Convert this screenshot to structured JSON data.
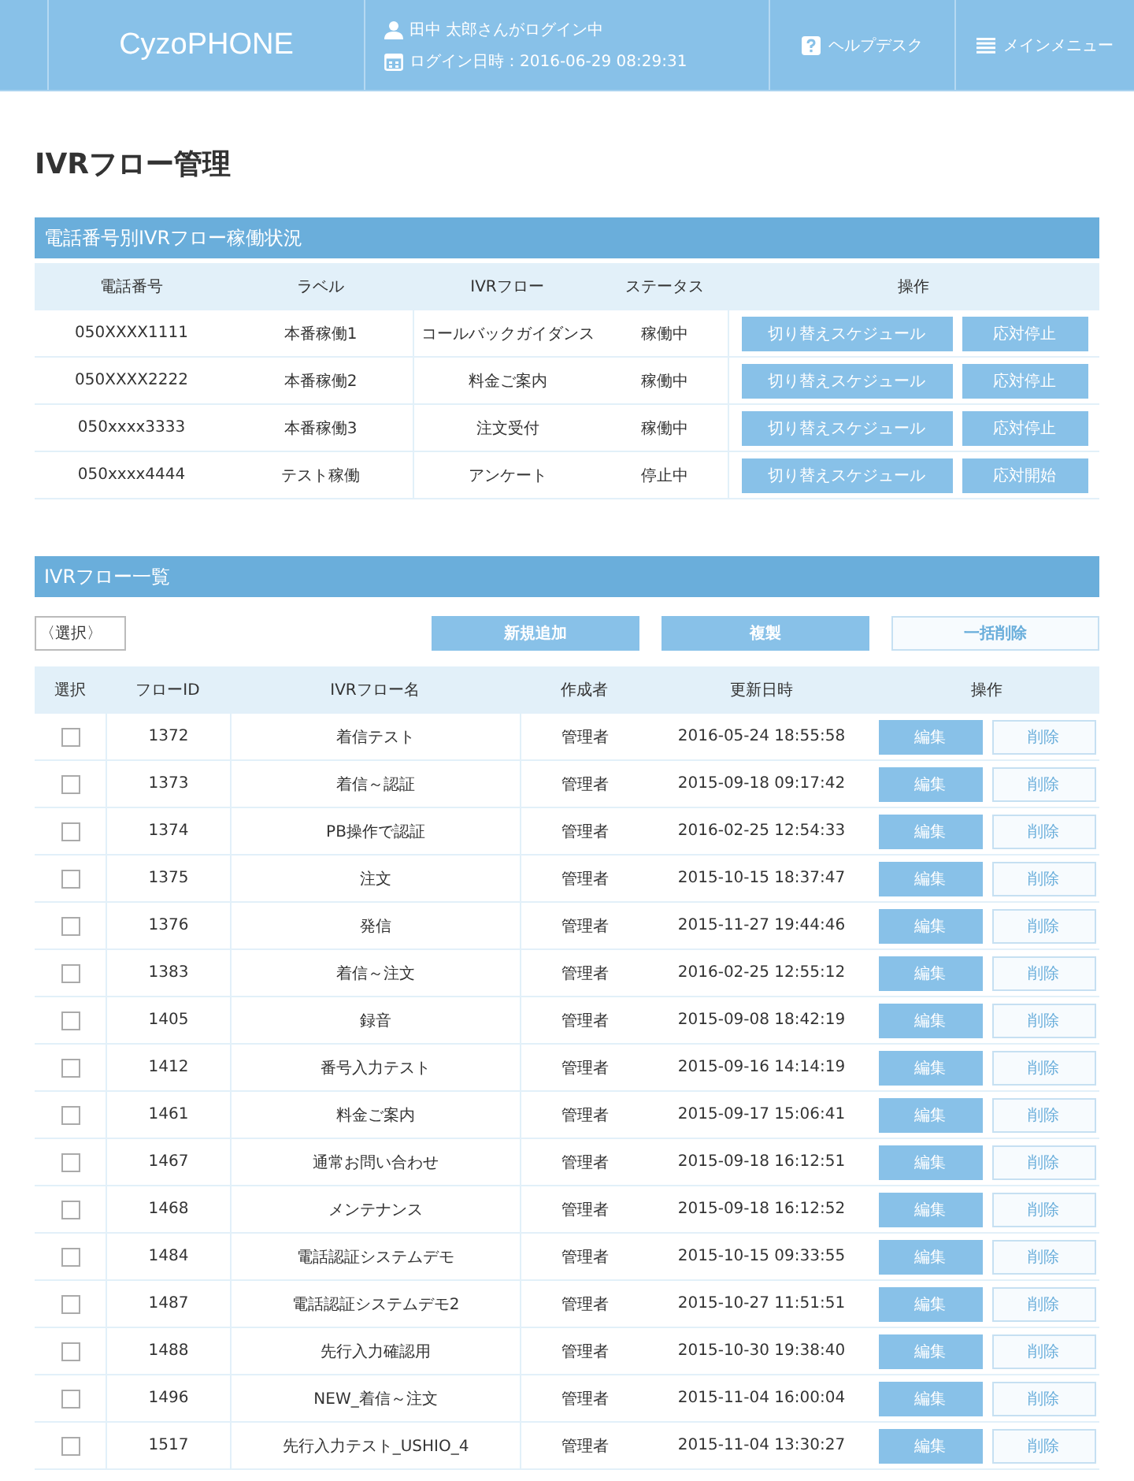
{
  "header": {
    "logo": "CyzoPHONE",
    "user": "田中 太郎さんがログイン中",
    "login_time": "ログイン日時：2016-06-29 08:29:31",
    "nav": [
      "ヘルプデスク",
      "メインメニュー"
    ]
  },
  "page_title": "IVRフロー管理",
  "status_section": {
    "title": "電話番号別IVRフロー稼働状況",
    "columns": [
      "電話番号",
      "ラベル",
      "IVRフロー",
      "ステータス",
      "操作"
    ],
    "rows": [
      {
        "phone": "050XXXX1111",
        "label": "本番稼働1",
        "flow": "コールバックガイダンス",
        "status": "稼働中",
        "actions": [
          "切り替えスケジュール",
          "応対停止"
        ]
      },
      {
        "phone": "050XXXX2222",
        "label": "本番稼働2",
        "flow": "料金ご案内",
        "status": "稼働中",
        "actions": [
          "切り替えスケジュール",
          "応対停止"
        ]
      },
      {
        "phone": "050xxxx3333",
        "label": "本番稼働3",
        "flow": "注文受付",
        "status": "稼働中",
        "actions": [
          "切り替えスケジュール",
          "応対停止"
        ]
      },
      {
        "phone": "050xxxx4444",
        "label": "テスト稼働",
        "flow": "アンケート",
        "status": "停止中",
        "actions": [
          "切り替えスケジュール",
          "応対開始"
        ]
      }
    ]
  },
  "flow_section": {
    "title": "IVRフロー一覧",
    "select": {
      "value": "〈選択〉"
    },
    "toolbar": [
      {
        "label": "新規追加",
        "kind": "primary"
      },
      {
        "label": "複製",
        "kind": "primary"
      },
      {
        "label": "一括削除",
        "kind": "secondary"
      }
    ],
    "columns": [
      "選択",
      "フローID",
      "IVRフロー名",
      "作成者",
      "更新日時",
      "操作"
    ],
    "rows": [
      {
        "checked": false,
        "id": "1372",
        "name": "着信テスト",
        "creator": "管理者",
        "updated": "2016-05-24 18:55:58",
        "actions": [
          {
            "label": "編集",
            "kind": "primary"
          },
          {
            "label": "削除",
            "kind": "secondary"
          }
        ]
      },
      {
        "checked": false,
        "id": "1373",
        "name": "着信～認証",
        "creator": "管理者",
        "updated": "2015-09-18 09:17:42",
        "actions": [
          {
            "label": "編集",
            "kind": "primary"
          },
          {
            "label": "削除",
            "kind": "secondary"
          }
        ]
      },
      {
        "checked": false,
        "id": "1374",
        "name": "PB操作で認証",
        "creator": "管理者",
        "updated": "2016-02-25 12:54:33",
        "actions": [
          {
            "label": "編集",
            "kind": "primary"
          },
          {
            "label": "削除",
            "kind": "secondary"
          }
        ]
      },
      {
        "checked": false,
        "id": "1375",
        "name": "注文",
        "creator": "管理者",
        "updated": "2015-10-15 18:37:47",
        "actions": [
          {
            "label": "編集",
            "kind": "primary"
          },
          {
            "label": "削除",
            "kind": "secondary"
          }
        ]
      },
      {
        "checked": false,
        "id": "1376",
        "name": "発信",
        "creator": "管理者",
        "updated": "2015-11-27 19:44:46",
        "actions": [
          {
            "label": "編集",
            "kind": "primary"
          },
          {
            "label": "削除",
            "kind": "secondary"
          }
        ]
      },
      {
        "checked": false,
        "id": "1383",
        "name": "着信～注文",
        "creator": "管理者",
        "updated": "2016-02-25 12:55:12",
        "actions": [
          {
            "label": "編集",
            "kind": "primary"
          },
          {
            "label": "削除",
            "kind": "secondary"
          }
        ]
      },
      {
        "checked": false,
        "id": "1405",
        "name": "録音",
        "creator": "管理者",
        "updated": "2015-09-08 18:42:19",
        "actions": [
          {
            "label": "編集",
            "kind": "primary"
          },
          {
            "label": "削除",
            "kind": "secondary"
          }
        ]
      },
      {
        "checked": false,
        "id": "1412",
        "name": "番号入力テスト",
        "creator": "管理者",
        "updated": "2015-09-16 14:14:19",
        "actions": [
          {
            "label": "編集",
            "kind": "primary"
          },
          {
            "label": "削除",
            "kind": "secondary"
          }
        ]
      },
      {
        "checked": false,
        "id": "1461",
        "name": "料金ご案内",
        "creator": "管理者",
        "updated": "2015-09-17 15:06:41",
        "actions": [
          {
            "label": "編集",
            "kind": "primary"
          },
          {
            "label": "削除",
            "kind": "secondary"
          }
        ]
      },
      {
        "checked": false,
        "id": "1467",
        "name": "通常お問い合わせ",
        "creator": "管理者",
        "updated": "2015-09-18 16:12:51",
        "actions": [
          {
            "label": "編集",
            "kind": "primary"
          },
          {
            "label": "削除",
            "kind": "secondary"
          }
        ]
      },
      {
        "checked": false,
        "id": "1468",
        "name": "メンテナンス",
        "creator": "管理者",
        "updated": "2015-09-18 16:12:52",
        "actions": [
          {
            "label": "編集",
            "kind": "primary"
          },
          {
            "label": "削除",
            "kind": "secondary"
          }
        ]
      },
      {
        "checked": false,
        "id": "1484",
        "name": "電話認証システムデモ",
        "creator": "管理者",
        "updated": "2015-10-15 09:33:55",
        "actions": [
          {
            "label": "編集",
            "kind": "primary"
          },
          {
            "label": "削除",
            "kind": "secondary"
          }
        ]
      },
      {
        "checked": false,
        "id": "1487",
        "name": "電話認証システムデモ2",
        "creator": "管理者",
        "updated": "2015-10-27 11:51:51",
        "actions": [
          {
            "label": "編集",
            "kind": "primary"
          },
          {
            "label": "削除",
            "kind": "secondary"
          }
        ]
      },
      {
        "checked": false,
        "id": "1488",
        "name": "先行入力確認用",
        "creator": "管理者",
        "updated": "2015-10-30 19:38:40",
        "actions": [
          {
            "label": "編集",
            "kind": "primary"
          },
          {
            "label": "削除",
            "kind": "secondary"
          }
        ]
      },
      {
        "checked": false,
        "id": "1496",
        "name": "NEW_着信～注文",
        "creator": "管理者",
        "updated": "2015-11-04 16:00:04",
        "actions": [
          {
            "label": "編集",
            "kind": "primary"
          },
          {
            "label": "削除",
            "kind": "secondary"
          }
        ]
      },
      {
        "checked": false,
        "id": "1517",
        "name": "先行入力テスト_USHIO_4",
        "creator": "管理者",
        "updated": "2015-11-04 13:30:27",
        "actions": [
          {
            "label": "編集",
            "kind": "primary"
          },
          {
            "label": "削除",
            "kind": "secondary"
          }
        ]
      }
    ]
  }
}
